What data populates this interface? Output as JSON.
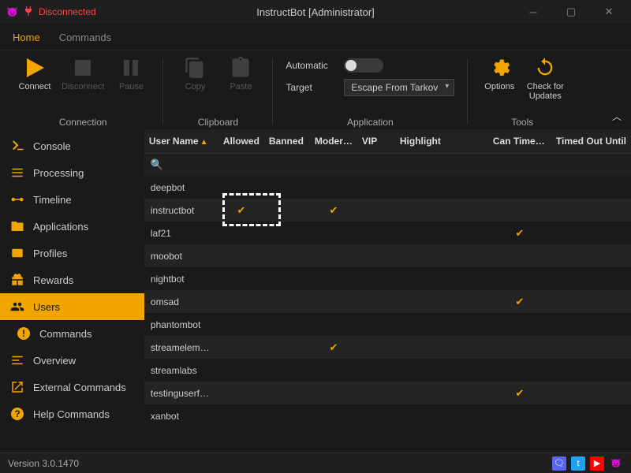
{
  "window": {
    "title": "InstructBot [Administrator]",
    "connection_status": "Disconnected"
  },
  "tabs": {
    "home": "Home",
    "commands": "Commands"
  },
  "ribbon": {
    "connection": {
      "label": "Connection",
      "connect": "Connect",
      "disconnect": "Disconnect",
      "pause": "Pause"
    },
    "clipboard": {
      "label": "Clipboard",
      "copy": "Copy",
      "paste": "Paste"
    },
    "application": {
      "label": "Application",
      "automatic": "Automatic",
      "target": "Target",
      "target_value": "Escape From Tarkov"
    },
    "tools": {
      "label": "Tools",
      "options": "Options",
      "update": "Check for\nUpdates"
    }
  },
  "sidebar": {
    "console": "Console",
    "processing": "Processing",
    "timeline": "Timeline",
    "applications": "Applications",
    "profiles": "Profiles",
    "rewards": "Rewards",
    "users": "Users",
    "commands": "Commands",
    "overview": "Overview",
    "external": "External Commands",
    "help": "Help Commands"
  },
  "grid": {
    "headers": {
      "user": "User Name",
      "allowed": "Allowed",
      "banned": "Banned",
      "mod": "Modera...",
      "vip": "VIP",
      "highlight": "Highlight",
      "timeout": "Can Timeout",
      "until": "Timed Out Until"
    },
    "rows": [
      {
        "user": "deepbot"
      },
      {
        "user": "instructbot",
        "allowed": true,
        "mod": true
      },
      {
        "user": "laf21",
        "timeout": true
      },
      {
        "user": "moobot"
      },
      {
        "user": "nightbot"
      },
      {
        "user": "omsad",
        "timeout": true
      },
      {
        "user": "phantombot"
      },
      {
        "user": "streameleme...",
        "mod": true
      },
      {
        "user": "streamlabs"
      },
      {
        "user": "testinguserfo...",
        "timeout": true
      },
      {
        "user": "xanbot"
      }
    ]
  },
  "status": {
    "version": "Version 3.0.1470"
  },
  "colors": {
    "accent": "#f0a500"
  }
}
